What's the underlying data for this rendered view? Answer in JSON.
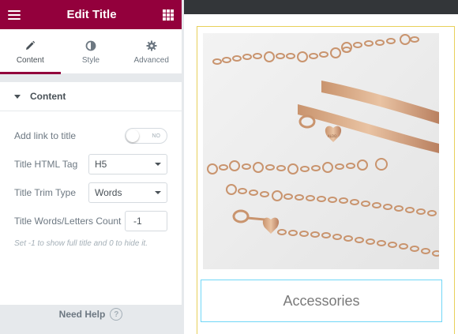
{
  "header": {
    "title": "Edit Title"
  },
  "tabs": [
    {
      "label": "Content",
      "active": true
    },
    {
      "label": "Style",
      "active": false
    },
    {
      "label": "Advanced",
      "active": false
    }
  ],
  "section": {
    "label": "Content"
  },
  "controls": {
    "link": {
      "label": "Add link to title",
      "toggle_text": "NO"
    },
    "html_tag": {
      "label": "Title HTML Tag",
      "value": "H5"
    },
    "trim_type": {
      "label": "Title Trim Type",
      "value": "Words"
    },
    "count": {
      "label": "Title Words/Letters Count",
      "value": "-1"
    },
    "hint": "Set -1 to show full title and 0 to hide it."
  },
  "help": {
    "label": "Need Help",
    "icon": "?"
  },
  "preview": {
    "caption": "Accessories",
    "charm_text": "ALDO"
  },
  "colors": {
    "brand": "#93003c",
    "caption_border": "#71d7f7",
    "card_border": "#e8d05a"
  }
}
